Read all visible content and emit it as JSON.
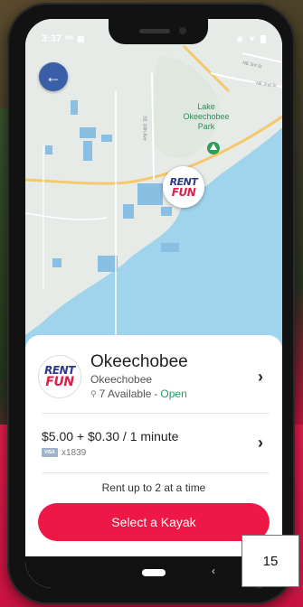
{
  "status_bar": {
    "time": "3:37",
    "ampm": "PM"
  },
  "map": {
    "park_label": "Lake Okeechobee Park",
    "road_labels": [
      "NE 3rd St",
      "NE 2nd St",
      "SE 34th Ave"
    ],
    "marker_logo_top": "RENT",
    "marker_logo_bottom": "FUN"
  },
  "station": {
    "logo_top": "RENT",
    "logo_bottom": "FUN",
    "name": "Okeechobee",
    "subtitle": "Okeechobee",
    "available": "7 Available",
    "separator": " - ",
    "status": "Open"
  },
  "pricing": {
    "price": "$5.00 + $0.30 / 1 minute",
    "card_brand": "VISA",
    "card_last4": "x1839"
  },
  "rent_limit": "Rent up to 2 at a time",
  "select_button": "Select a Kayak",
  "page_number": "15",
  "colors": {
    "accent": "#ee1846",
    "back_button": "#3b5ea8",
    "open": "#22a06b",
    "water": "#9fd4ec"
  }
}
